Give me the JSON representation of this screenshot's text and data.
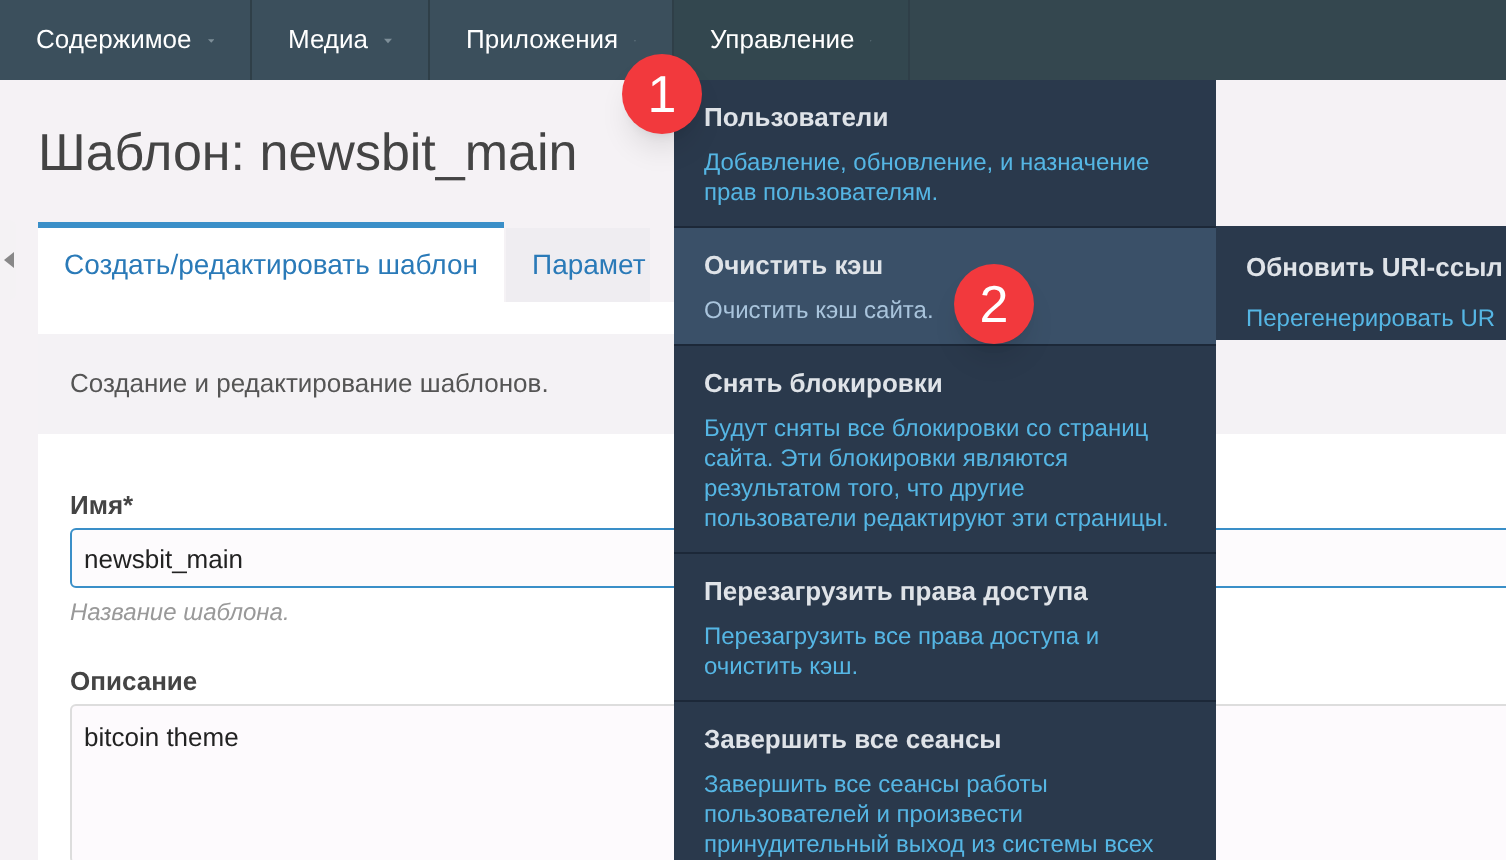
{
  "nav": [
    {
      "label": "Содержимое",
      "selected": false
    },
    {
      "label": "Медиа",
      "selected": false
    },
    {
      "label": "Приложения",
      "selected": false
    },
    {
      "label": "Управление",
      "selected": true
    }
  ],
  "page": {
    "title": "Шаблон: newsbit_main"
  },
  "tabs": [
    {
      "label": "Создать/редактировать шаблон",
      "selected": true
    },
    {
      "label": "Парамет",
      "selected": false
    }
  ],
  "tab_description": "Создание и редактирование шаблонов.",
  "fields": [
    {
      "kind": "input",
      "label": "Имя*",
      "value": "newsbit_main",
      "hint": "Название шаблона.",
      "focused": true
    },
    {
      "kind": "textarea",
      "label": "Описание",
      "value": "bitcoin theme",
      "focused": false
    }
  ],
  "dropdown": {
    "items": [
      {
        "title": "Пользователи",
        "description": "Добавление, обновление, и назначение\nправ пользователям.",
        "selected": false
      },
      {
        "title": "Очистить кэш",
        "description": "Очистить кэш сайта.",
        "selected": true
      },
      {
        "title": "Снять блокировки",
        "description": "Будут сняты все блокировки со страниц\nсайта. Эти блокировки являются\nрезультатом того, что другие\nпользователи редактируют эти страницы.",
        "selected": false
      },
      {
        "title": "Перезагрузить права доступа",
        "description": "Перезагрузить все права доступа и\nочистить кэш.",
        "selected": false
      },
      {
        "title": "Завершить все сеансы",
        "description": "Завершить все сеансы работы\nпользователей и произвести\nпринудительный выход из системы всех",
        "selected": false
      }
    ]
  },
  "submenu": {
    "title": "Обновить URI-ссыл",
    "description": "Перегенерировать UR"
  },
  "callouts": [
    "1",
    "2"
  ]
}
